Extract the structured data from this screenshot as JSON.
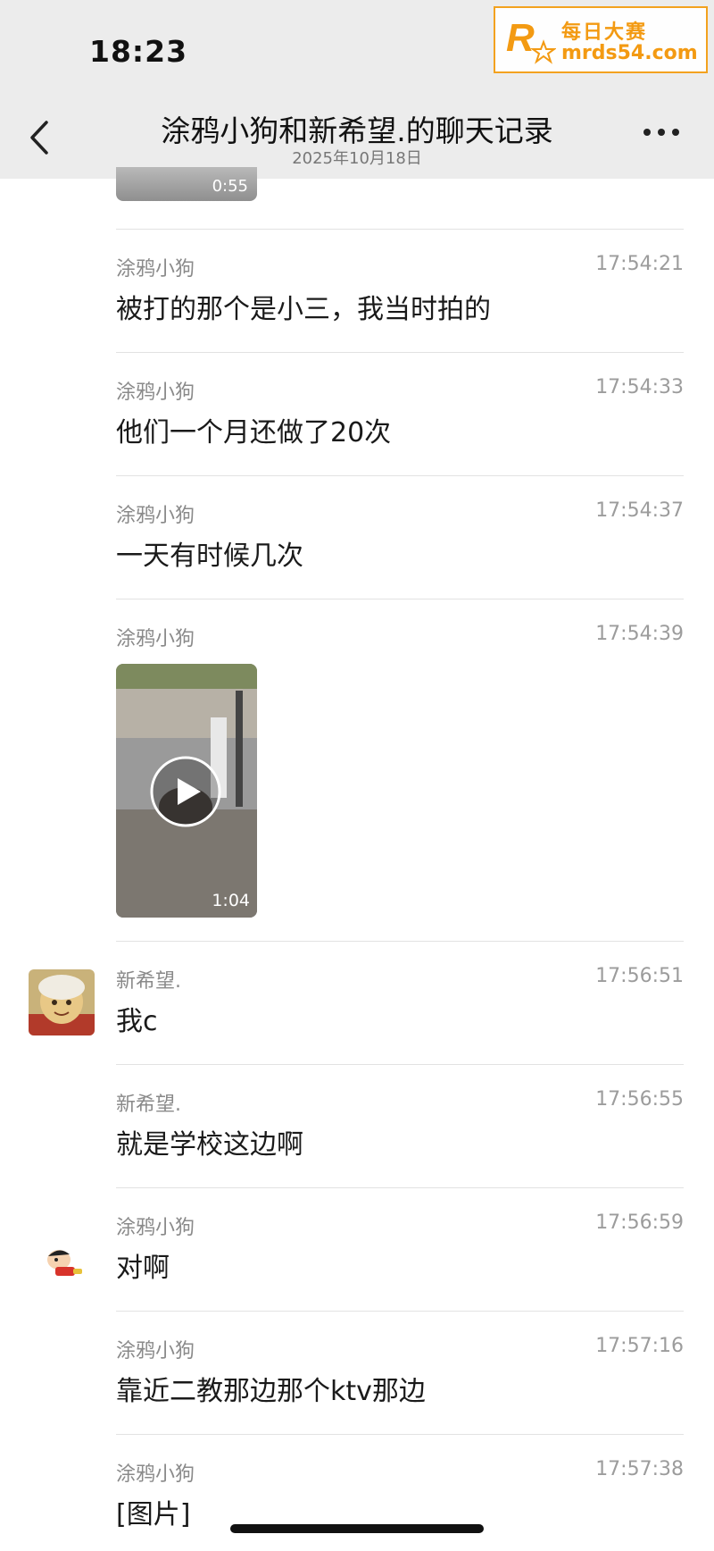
{
  "status_bar": {
    "time": "18:23"
  },
  "watermark": {
    "logo_text": "R",
    "name": "每日大赛",
    "url": "mrds54.com"
  },
  "header": {
    "title": "涂鸦小狗和新希望.的聊天记录",
    "date": "2025年10月18日",
    "back_icon": "chevron-left-icon",
    "more_icon": "ellipsis-icon"
  },
  "top_video": {
    "duration": "0:55"
  },
  "messages": [
    {
      "sender": "涂鸦小狗",
      "time": "17:54:21",
      "text": "被打的那个是小三，我当时拍的"
    },
    {
      "sender": "涂鸦小狗",
      "time": "17:54:33",
      "text": "他们一个月还做了20次"
    },
    {
      "sender": "涂鸦小狗",
      "time": "17:54:37",
      "text": "一天有时候几次"
    },
    {
      "sender": "涂鸦小狗",
      "time": "17:54:39",
      "video_duration": "1:04"
    },
    {
      "sender": "新希望.",
      "time": "17:56:51",
      "text": "我c"
    },
    {
      "sender": "新希望.",
      "time": "17:56:55",
      "text": "就是学校这边啊"
    },
    {
      "sender": "涂鸦小狗",
      "time": "17:56:59",
      "text": "对啊"
    },
    {
      "sender": "涂鸦小狗",
      "time": "17:57:16",
      "text": "靠近二教那边那个ktv那边"
    },
    {
      "sender": "涂鸦小狗",
      "time": "17:57:38",
      "text": "[图片]"
    }
  ]
}
